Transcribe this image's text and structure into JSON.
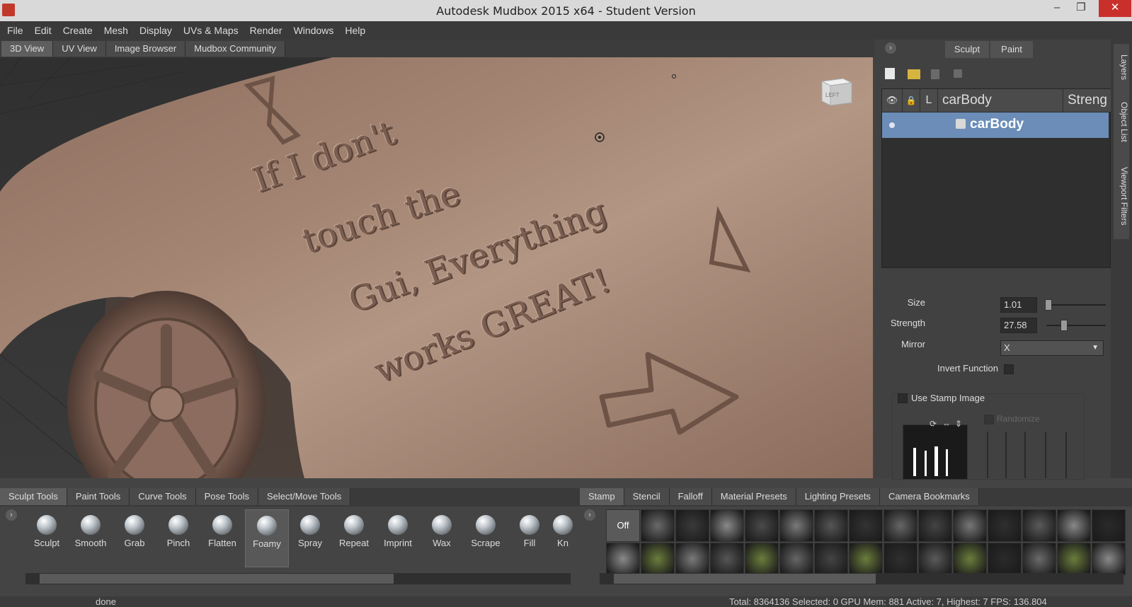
{
  "window": {
    "title": "Autodesk Mudbox 2015 x64 - Student Version",
    "minimize": "–",
    "maximize": "❐",
    "close": "✕"
  },
  "menu": [
    "File",
    "Edit",
    "Create",
    "Mesh",
    "Display",
    "UVs & Maps",
    "Render",
    "Windows",
    "Help"
  ],
  "view_tabs": [
    "3D View",
    "UV View",
    "Image Browser",
    "Mudbox Community"
  ],
  "viewport": {
    "cube_label": "LEFT",
    "sculpt_text": [
      "If I don't",
      "touch the",
      "Gui, Everything",
      "works GREAT!"
    ]
  },
  "right_panel": {
    "mode_tabs": [
      "Sculpt",
      "Paint"
    ],
    "layer_table": {
      "columns": [
        "L",
        "carBody",
        "Streng"
      ],
      "row_name": "carBody"
    },
    "props": {
      "size_label": "Size",
      "size_value": "1.01",
      "strength_label": "Strength",
      "strength_value": "27.58",
      "mirror_label": "Mirror",
      "mirror_value": "X",
      "invert_label": "Invert Function",
      "stamp_label": "Use Stamp Image",
      "randomize_label": "Randomize"
    },
    "sliders": {
      "size_fraction": 0.02,
      "strength_fraction": 0.28
    },
    "side_tabs": [
      "Layers",
      "Object List",
      "Viewport Filters"
    ]
  },
  "tool_tabs": [
    "Sculpt Tools",
    "Paint Tools",
    "Curve Tools",
    "Pose Tools",
    "Select/Move Tools"
  ],
  "tools": [
    "Sculpt",
    "Smooth",
    "Grab",
    "Pinch",
    "Flatten",
    "Foamy",
    "Spray",
    "Repeat",
    "Imprint",
    "Wax",
    "Scrape",
    "Fill",
    "Kn"
  ],
  "active_tool": "Foamy",
  "stamp_tabs": [
    "Stamp",
    "Stencil",
    "Falloff",
    "Material Presets",
    "Lighting Presets",
    "Camera Bookmarks"
  ],
  "stamp_off": "Off",
  "status": {
    "left": "done",
    "right": "Total: 8364136  Selected: 0 GPU Mem: 881  Active: 7, Highest: 7  FPS: 136.804"
  },
  "colors": {
    "clay": "#9b7b6a",
    "selection": "#6b8db8",
    "close": "#c9302c"
  }
}
